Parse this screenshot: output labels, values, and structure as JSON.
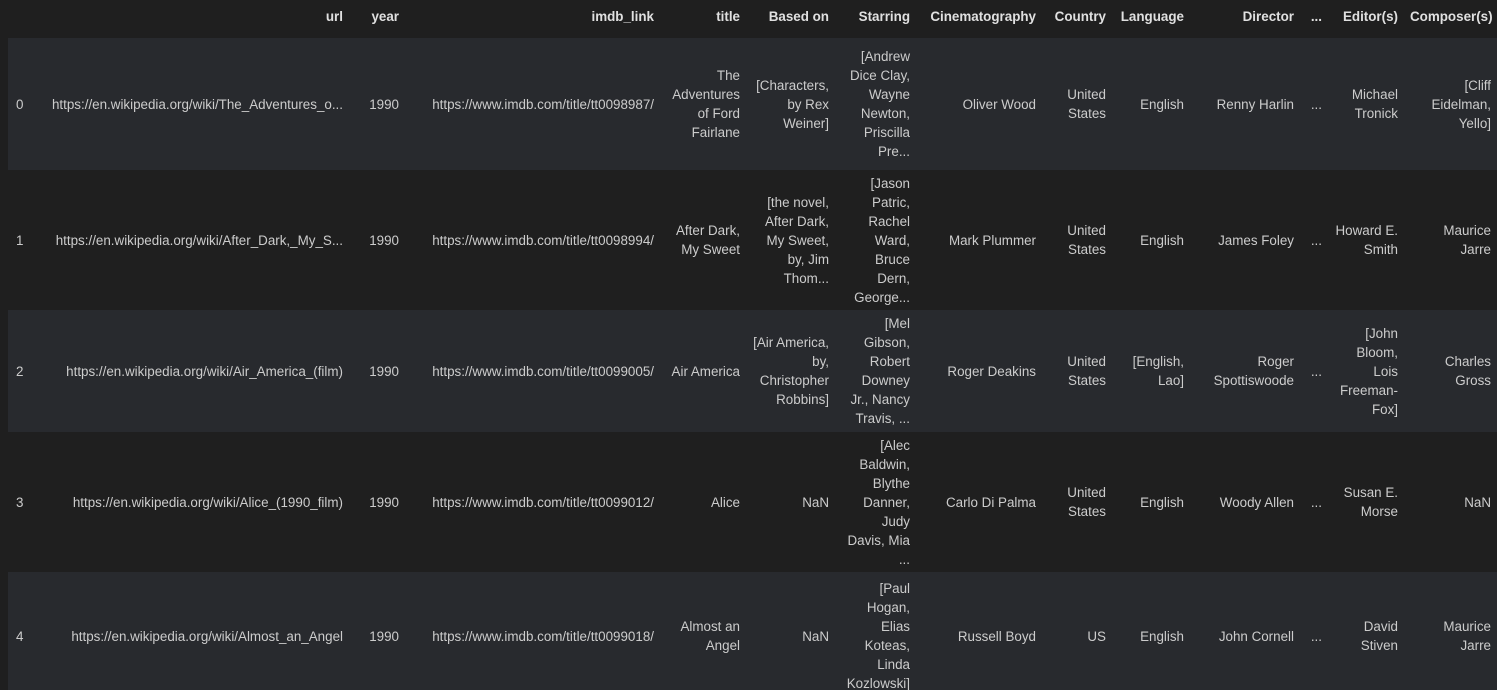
{
  "columns": [
    "",
    "url",
    "year",
    "imdb_link",
    "title",
    "Based on",
    "Starring",
    "Cinematography",
    "Country",
    "Language",
    "Director",
    "...",
    "Editor(s)",
    "Composer(s)"
  ],
  "rows": [
    {
      "index": "0",
      "url": "https://en.wikipedia.org/wiki/The_Adventures_o...",
      "year": "1990",
      "imdb_link": "https://www.imdb.com/title/tt0098987/",
      "title": "The Adventures of Ford Fairlane",
      "based_on": "[Characters, by Rex Weiner]",
      "starring": "[Andrew Dice Clay, Wayne Newton, Priscilla Pre...",
      "cinematography": "Oliver Wood",
      "country": "United States",
      "language": "English",
      "director": "Renny Harlin",
      "ellipsis": "...",
      "editors": "Michael Tronick",
      "composers": "[Cliff Eidelman, Yello]"
    },
    {
      "index": "1",
      "url": "https://en.wikipedia.org/wiki/After_Dark,_My_S...",
      "year": "1990",
      "imdb_link": "https://www.imdb.com/title/tt0098994/",
      "title": "After Dark, My Sweet",
      "based_on": "[the novel, After Dark, My Sweet, by, Jim Thom...",
      "starring": "[Jason Patric, Rachel Ward, Bruce Dern, George...",
      "cinematography": "Mark Plummer",
      "country": "United States",
      "language": "English",
      "director": "James Foley",
      "ellipsis": "...",
      "editors": "Howard E. Smith",
      "composers": "Maurice Jarre"
    },
    {
      "index": "2",
      "url": "https://en.wikipedia.org/wiki/Air_America_(film)",
      "year": "1990",
      "imdb_link": "https://www.imdb.com/title/tt0099005/",
      "title": "Air America",
      "based_on": "[Air America, by, Christopher Robbins]",
      "starring": "[Mel Gibson, Robert Downey Jr., Nancy Travis, ...",
      "cinematography": "Roger Deakins",
      "country": "United States",
      "language": "[English, Lao]",
      "director": "Roger Spottiswoode",
      "ellipsis": "...",
      "editors": "[John Bloom, Lois Freeman-Fox]",
      "composers": "Charles Gross"
    },
    {
      "index": "3",
      "url": "https://en.wikipedia.org/wiki/Alice_(1990_film)",
      "year": "1990",
      "imdb_link": "https://www.imdb.com/title/tt0099012/",
      "title": "Alice",
      "based_on": "NaN",
      "starring": "[Alec Baldwin, Blythe Danner, Judy Davis, Mia ...",
      "cinematography": "Carlo Di Palma",
      "country": "United States",
      "language": "English",
      "director": "Woody Allen",
      "ellipsis": "...",
      "editors": "Susan E. Morse",
      "composers": "NaN"
    },
    {
      "index": "4",
      "url": "https://en.wikipedia.org/wiki/Almost_an_Angel",
      "year": "1990",
      "imdb_link": "https://www.imdb.com/title/tt0099018/",
      "title": "Almost an Angel",
      "based_on": "NaN",
      "starring": "[Paul Hogan, Elias Koteas, Linda Kozlowski]",
      "cinematography": "Russell Boyd",
      "country": "US",
      "language": "English",
      "director": "John Cornell",
      "ellipsis": "...",
      "editors": "David Stiven",
      "composers": "Maurice Jarre"
    }
  ]
}
